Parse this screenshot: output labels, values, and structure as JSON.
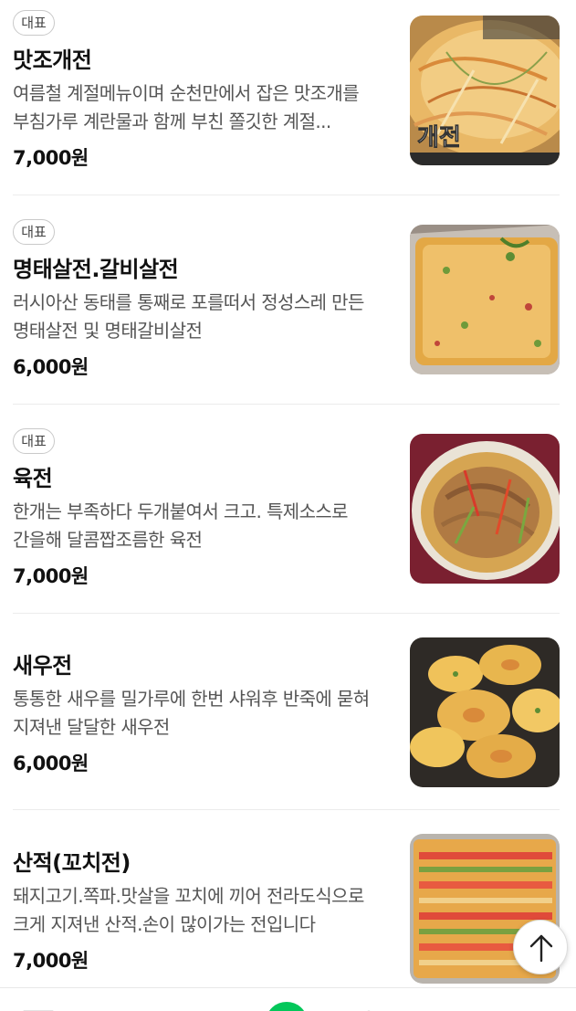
{
  "badge_label": "대표",
  "items": [
    {
      "name": "맛조개전",
      "description": "여름철 계절메뉴이며 순천만에서 잡은 맛조개를 부침가루 계란물과 함께 부친 쫄깃한 계절...",
      "price": "7,000원",
      "featured": true
    },
    {
      "name": "명태살전.갈비살전",
      "description": "러시아산 동태를 통째로 포를떠서 정성스레 만든 명태살전 및 명태갈비살전",
      "price": "6,000원",
      "featured": true
    },
    {
      "name": "육전",
      "description": "한개는 부족하다 두개붙여서 크고. 특제소스로 간을해 달콤짭조름한 육전",
      "price": "7,000원",
      "featured": true
    },
    {
      "name": "새우전",
      "description": "통통한 새우를 밀가루에 한번 샤워후 반죽에 묻혀 지져낸 달달한 새우전",
      "price": "6,000원",
      "featured": false
    },
    {
      "name": "산적(꼬치전)",
      "description": "돼지고기.쪽파.맛살을 꼬치에 끼어 전라도식으로 크게 지져낸 산적.손이 많이가는 전입니다",
      "price": "7,000원",
      "featured": false
    }
  ],
  "thumbnail_overlay_text": "개전",
  "colors": {
    "accent_green": "#03c75a",
    "divider": "#ececec"
  }
}
